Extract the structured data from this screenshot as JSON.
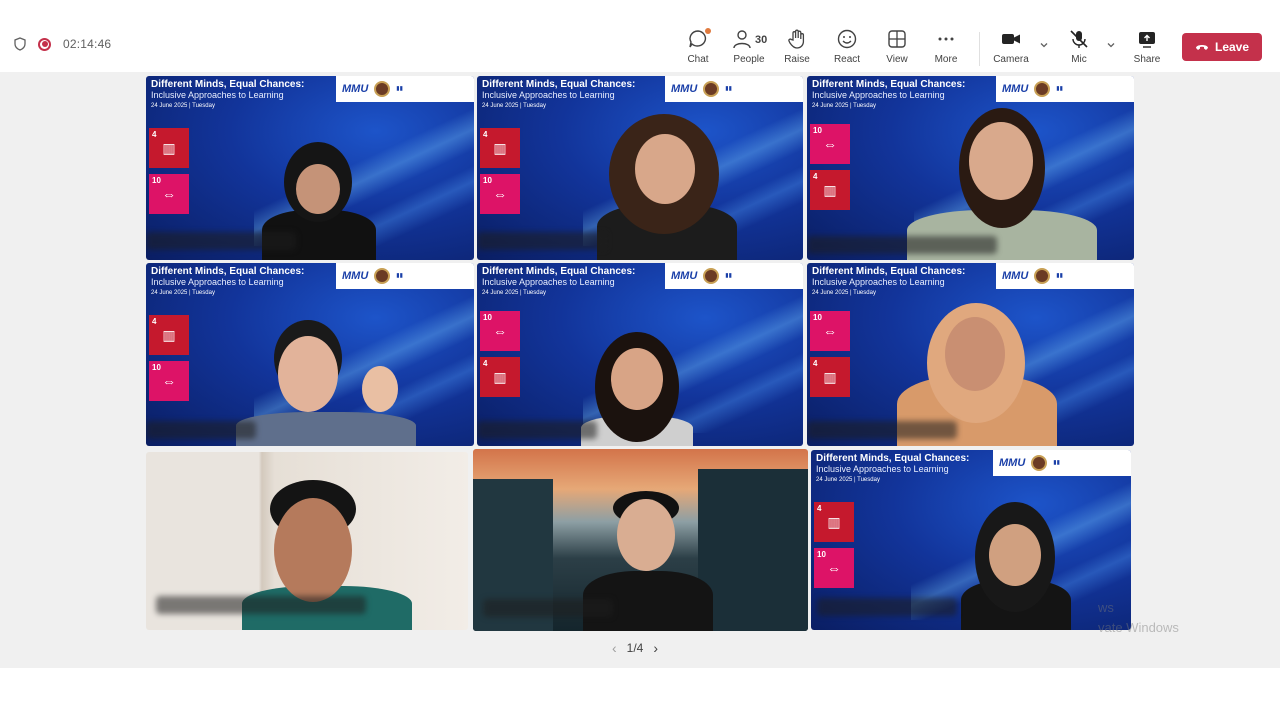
{
  "meeting": {
    "timer": "02:14:46"
  },
  "toolbar": {
    "chat_label": "Chat",
    "people_label": "People",
    "people_count": "30",
    "raise_label": "Raise",
    "react_label": "React",
    "view_label": "View",
    "more_label": "More",
    "camera_label": "Camera",
    "mic_label": "Mic",
    "share_label": "Share",
    "leave_label": "Leave"
  },
  "slide": {
    "title_line1": "Different Minds, Equal Chances:",
    "title_line2": "Inclusive Approaches to Learning",
    "date": "24 June 2025 | Tuesday",
    "logo_mmu": "MMU",
    "sdg4_number": "4",
    "sdg10_number": "10"
  },
  "pager": {
    "label": "1/4"
  },
  "watermark": {
    "line1": "ws",
    "line2": "vate Windows"
  },
  "colors": {
    "leave_red": "#c4314b",
    "slide_blue": "#12349a",
    "sdg4": "#c5192d",
    "sdg10": "#dd1367"
  }
}
